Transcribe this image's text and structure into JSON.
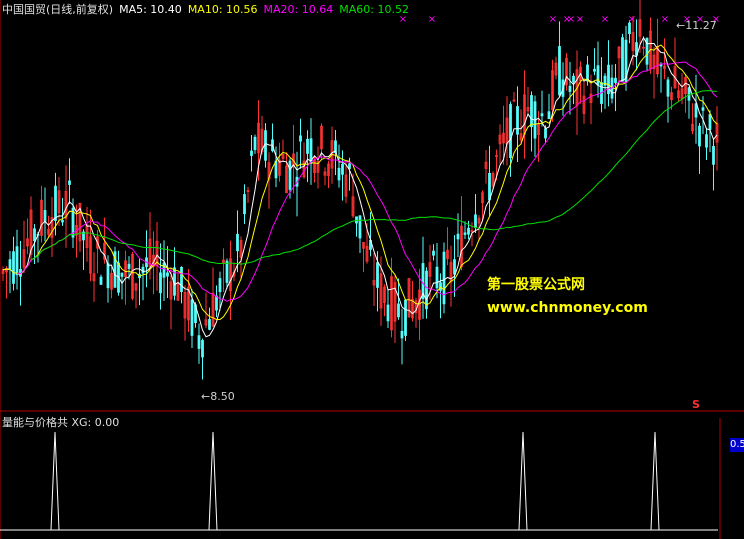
{
  "header": {
    "security": "中国国贸(日线,前复权)",
    "ma5": "MA5: 10.40",
    "ma10": "MA10: 10.56",
    "ma20": "MA20: 10.64",
    "ma60": "MA60: 10.52"
  },
  "sub_header": {
    "indicator": "量能与价格共",
    "xg": "XG: 0.00"
  },
  "watermark": {
    "title": "第一股票公式网",
    "url": "www.chnmoney.com"
  },
  "annotations": {
    "low": "8.50",
    "high": "11.27",
    "s_mark": "S",
    "sub_axis_value": "0.5"
  },
  "colors": {
    "up": "#ff3232",
    "down": "#54fcfc",
    "ma5": "#ffffff",
    "ma10": "#ffff00",
    "ma20": "#ff00ff",
    "ma60": "#00e000",
    "signal_mark": "#ff00ff"
  },
  "chart_data": {
    "type": "line",
    "title": "中国国贸(日线,前复权)",
    "price_range": [
      8.3,
      11.6
    ],
    "low": 8.5,
    "high": 11.27,
    "series": [
      {
        "name": "MA5",
        "last": 10.4
      },
      {
        "name": "MA10",
        "last": 10.56
      },
      {
        "name": "MA20",
        "last": 10.64
      },
      {
        "name": "MA60",
        "last": 10.52
      }
    ],
    "indicator": {
      "name": "量能与价格共",
      "xg": 0.0,
      "signal_points": [
        55,
        213,
        523,
        655
      ]
    }
  }
}
